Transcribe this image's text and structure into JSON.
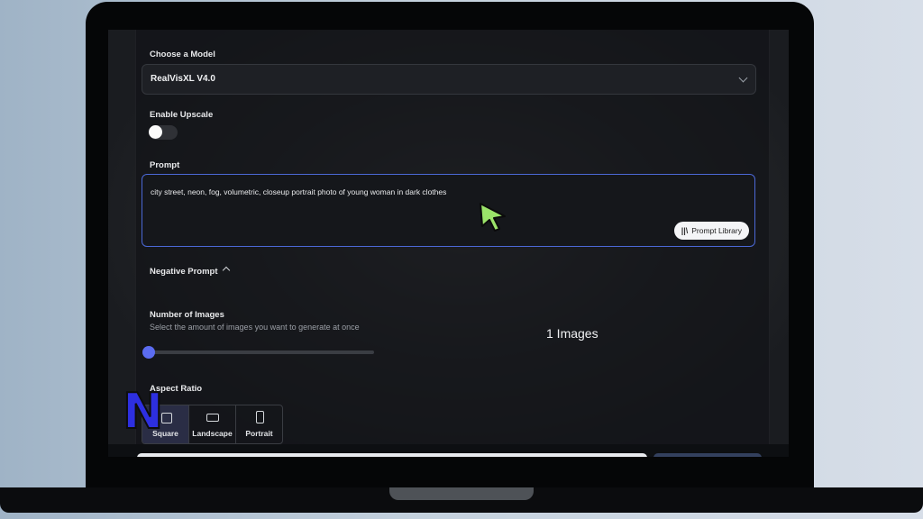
{
  "form": {
    "model_label": "Choose a Model",
    "model_value": "RealVisXL V4.0",
    "upscale_label": "Enable Upscale",
    "upscale_on": false,
    "prompt_label": "Prompt",
    "prompt_value": "city street, neon, fog, volumetric, closeup portrait photo of young woman in dark clothes",
    "prompt_library_label": "Prompt Library",
    "negative_prompt_label": "Negative Prompt",
    "images_label": "Number of Images",
    "images_hint": "Select the amount of images you want to generate at once",
    "images_count": "1 Images",
    "images_value": 1,
    "aspect_label": "Aspect Ratio",
    "aspect_options": [
      "Square",
      "Landscape",
      "Portrait"
    ],
    "aspect_selected": "Square"
  },
  "branding": {
    "logo_letter": "N"
  },
  "colors": {
    "accent": "#5b6cf0",
    "focus_border": "#4b68d6",
    "cursor": "#9be36a",
    "logo": "#2d2fe0"
  }
}
